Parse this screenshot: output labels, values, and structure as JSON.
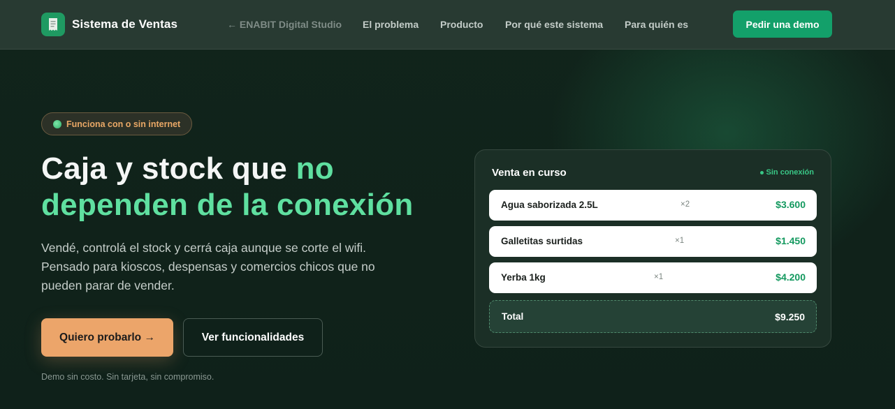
{
  "nav": {
    "brand_name": "Sistema de Ventas",
    "brand_icon": "receipt-icon",
    "links": [
      {
        "label": "← ENABIT Digital Studio"
      },
      {
        "label": "El problema"
      },
      {
        "label": "Producto"
      },
      {
        "label": "Por qué este sistema"
      },
      {
        "label": "Para quién es"
      }
    ],
    "cta_label": "Pedir una demo"
  },
  "hero": {
    "badge_text": "Funciona con o sin internet",
    "headline_plain": "Caja y stock que ",
    "headline_accent_1": "no",
    "headline_accent_2": "dependen de la conexión",
    "subtext": "Vendé, controlá el stock y cerrá caja aunque se corte el wifi. Pensado para kioscos, despensas y comercios chicos que no pueden parar de vender.",
    "primary_button": "Quiero probarlo →",
    "secondary_button": "Ver funcionalidades",
    "note": "Demo sin costo. Sin tarjeta, sin compromiso."
  },
  "sale_card": {
    "title": "Venta en curso",
    "status": "Sin conexión",
    "items": [
      {
        "name": "Agua saborizada 2.5L",
        "qty": "×2",
        "price": "$3.600"
      },
      {
        "name": "Galletitas surtidas",
        "qty": "×1",
        "price": "$1.450"
      },
      {
        "name": "Yerba 1kg",
        "qty": "×1",
        "price": "$4.200"
      }
    ],
    "total_label": "Total",
    "total_value": "$9.250"
  },
  "colors": {
    "accent_green": "#5fe0a0",
    "cta_green": "#13a06a",
    "orange": "#eca56a",
    "background": "#10221a"
  }
}
